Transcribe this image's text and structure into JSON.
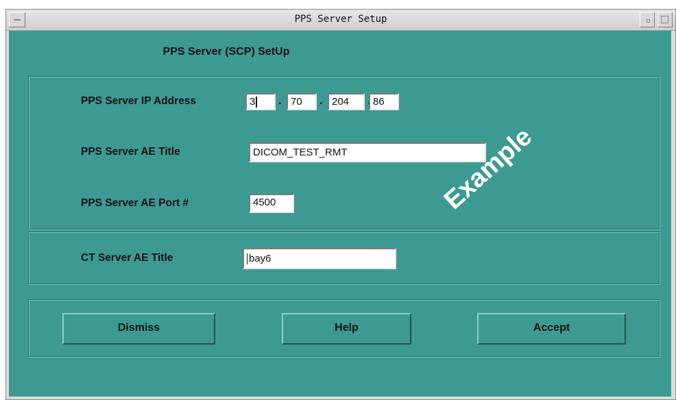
{
  "window": {
    "title": "PPS Server Setup"
  },
  "dialog": {
    "heading": "PPS Server (SCP) SetUp"
  },
  "fields": {
    "ip_label": "PPS Server IP Address",
    "ip_octets": [
      "3",
      "70",
      "204",
      "86"
    ],
    "ip_separator": ".",
    "ae_title_label": "PPS Server AE Title",
    "ae_title_value": "DICOM_TEST_RMT",
    "ae_port_label": "PPS Server AE Port #",
    "ae_port_value": "4500",
    "ct_title_label": "CT Server AE Title",
    "ct_title_value": "bay6"
  },
  "buttons": {
    "dismiss": "Dismiss",
    "help": "Help",
    "accept": "Accept"
  },
  "watermark": "Example",
  "colors": {
    "client_background": "#3d9a93",
    "titlebar": "#dcdcdc",
    "field_background": "#ffffff"
  },
  "icons": {
    "window_menu": "window-menu-icon",
    "minimize": "minimize-icon",
    "maximize": "maximize-icon"
  }
}
